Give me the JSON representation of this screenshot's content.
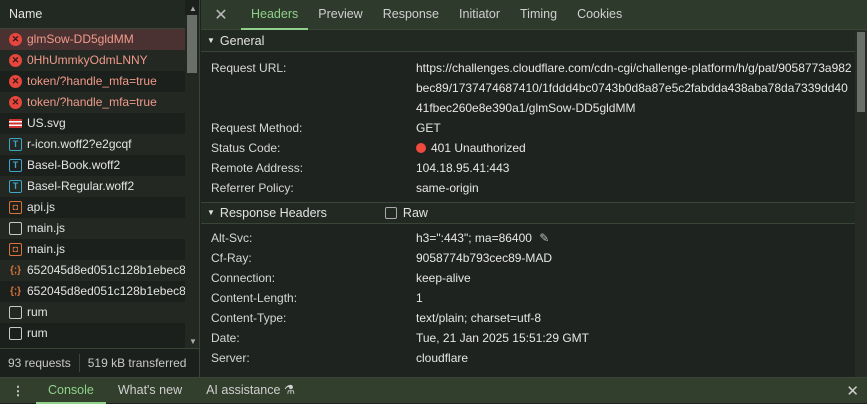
{
  "requests": {
    "header": "Name",
    "items": [
      {
        "name": "glmSow-DD5gldMM",
        "icon": "error",
        "error": true
      },
      {
        "name": "0HhUmmkyOdmLNNY",
        "icon": "error",
        "error": true
      },
      {
        "name": "token/?handle_mfa=true",
        "icon": "error",
        "error": true
      },
      {
        "name": "token/?handle_mfa=true",
        "icon": "error",
        "error": true
      },
      {
        "name": "US.svg",
        "icon": "flag"
      },
      {
        "name": "r-icon.woff2?e2gcqf",
        "icon": "font"
      },
      {
        "name": "Basel-Book.woff2",
        "icon": "font"
      },
      {
        "name": "Basel-Regular.woff2",
        "icon": "font"
      },
      {
        "name": "api.js",
        "icon": "script"
      },
      {
        "name": "main.js",
        "icon": "doc"
      },
      {
        "name": "main.js",
        "icon": "script"
      },
      {
        "name": "652045d8ed051c128b1ebec8",
        "icon": "json"
      },
      {
        "name": "652045d8ed051c128b1ebec8",
        "icon": "json"
      },
      {
        "name": "rum",
        "icon": "doc"
      },
      {
        "name": "rum",
        "icon": "file"
      }
    ],
    "status": {
      "count": "93 requests",
      "transferred": "519 kB transferred"
    }
  },
  "tabs": [
    "Headers",
    "Preview",
    "Response",
    "Initiator",
    "Timing",
    "Cookies"
  ],
  "general": {
    "title": "General",
    "rows": [
      {
        "k": "Request URL:",
        "v": "https://challenges.cloudflare.com/cdn-cgi/challenge-platform/h/g/pat/9058773a982bec89/1737474687410/1fddd4bc0743b0d8a87e5c2fabdda438aba78da7339dd4041fbec260e8e390a1/glmSow-DD5gldMM"
      },
      {
        "k": "Request Method:",
        "v": "GET"
      },
      {
        "k": "Status Code:",
        "v": "401 Unauthorized"
      },
      {
        "k": "Remote Address:",
        "v": "104.18.95.41:443"
      },
      {
        "k": "Referrer Policy:",
        "v": "same-origin"
      }
    ]
  },
  "response_headers": {
    "title": "Response Headers",
    "raw_label": "Raw",
    "rows": [
      {
        "k": "Alt-Svc:",
        "v": "h3=\":443\"; ma=86400"
      },
      {
        "k": "Cf-Ray:",
        "v": "9058774b793cec89-MAD"
      },
      {
        "k": "Connection:",
        "v": "keep-alive"
      },
      {
        "k": "Content-Length:",
        "v": "1"
      },
      {
        "k": "Content-Type:",
        "v": "text/plain; charset=utf-8"
      },
      {
        "k": "Date:",
        "v": "Tue, 21 Jan 2025 15:51:29 GMT"
      },
      {
        "k": "Server:",
        "v": "cloudflare"
      }
    ]
  },
  "drawer": {
    "tabs": [
      "Console",
      "What's new",
      "AI assistance"
    ]
  }
}
